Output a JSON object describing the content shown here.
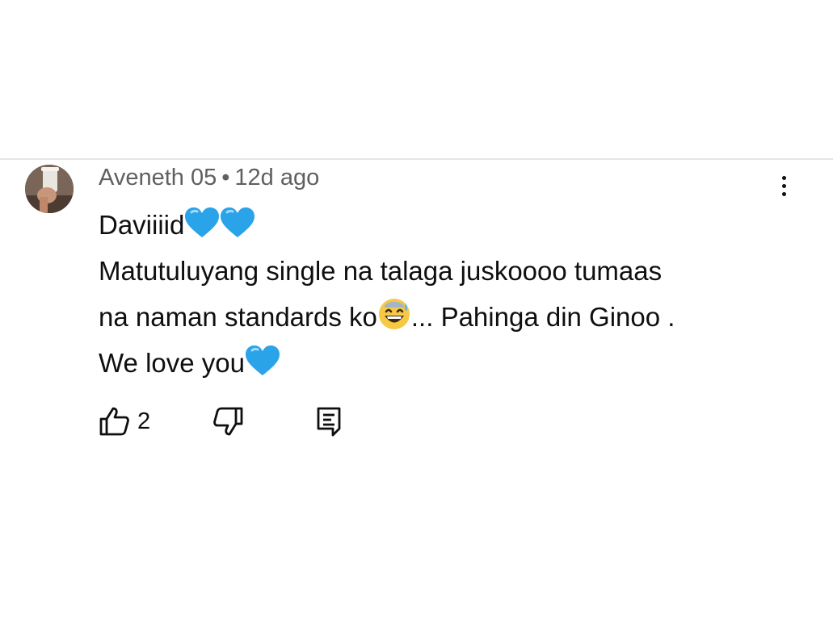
{
  "comment": {
    "author": "Aveneth 05",
    "separator": "•",
    "age": "12d ago",
    "lines": [
      {
        "text": "Daviiiid",
        "emoji": [
          "blue-heart",
          "blue-heart"
        ],
        "after": ""
      },
      {
        "text": "Matutuluyang single na talaga juskoooo tumaas",
        "emoji": [],
        "after": ""
      },
      {
        "text": "na naman standards ko",
        "emoji": [
          "grinning-sweat"
        ],
        "after": "... Pahinga din Ginoo ."
      },
      {
        "text": "We love you",
        "emoji": [
          "blue-heart"
        ],
        "after": ""
      }
    ],
    "like_count": "2"
  },
  "icons": {
    "menu": "more-vertical-icon",
    "like": "thumbs-up-icon",
    "dislike": "thumbs-down-icon",
    "reply": "reply-comment-icon"
  },
  "colors": {
    "text": "#0f0f0f",
    "meta": "#606060",
    "divider": "#e5e5e5",
    "heart": "#2aa3e8"
  }
}
